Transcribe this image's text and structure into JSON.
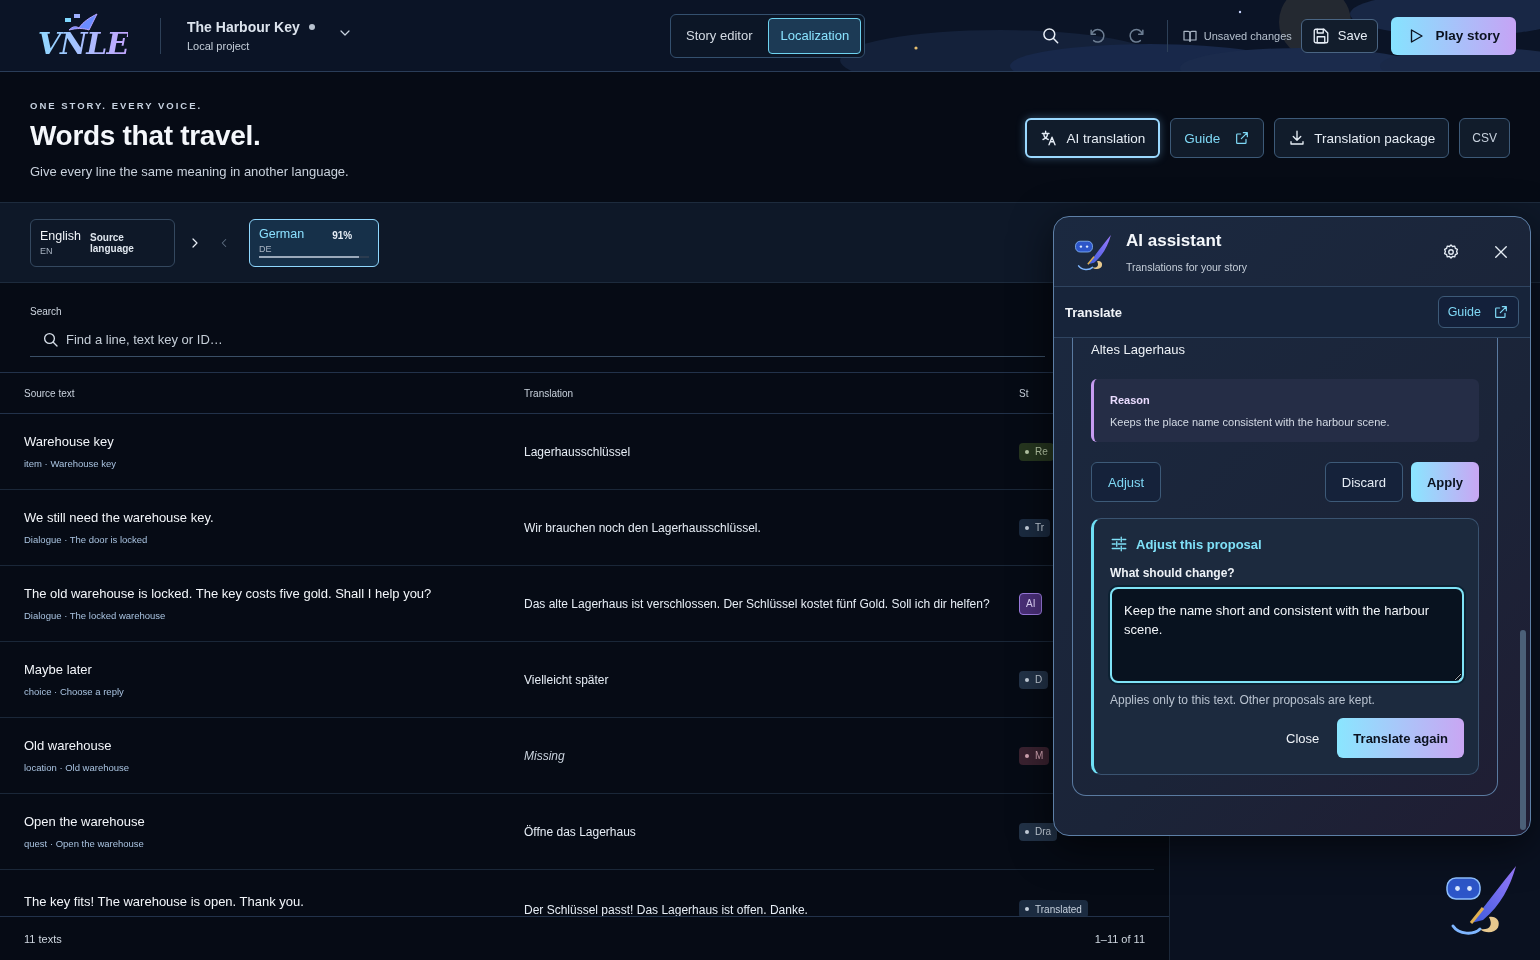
{
  "header": {
    "logo": "VNLE",
    "project": {
      "title": "The Harbour Key",
      "subtitle": "Local project"
    },
    "modes": [
      {
        "label": "Story editor",
        "selected": false
      },
      {
        "label": "Localization",
        "selected": true
      }
    ],
    "status": "Unsaved changes",
    "save": "Save",
    "play": "Play story"
  },
  "hero": {
    "eyebrow": "ONE STORY. EVERY VOICE.",
    "title": "Words that travel.",
    "subtitle": "Give every line the same meaning in another language.",
    "actions": [
      {
        "label": "AI translation",
        "kind": "ai"
      },
      {
        "label": "Guide",
        "kind": "link"
      },
      {
        "label": "Translation package",
        "kind": "download"
      },
      {
        "label": "CSV",
        "kind": "plain"
      }
    ]
  },
  "languages": {
    "source": {
      "name": "English",
      "code": "EN",
      "role": "Source language"
    },
    "targets": [
      {
        "name": "German",
        "code": "DE",
        "percent": "91%",
        "level": 0.91,
        "selected": true
      }
    ]
  },
  "search": {
    "label": "Search",
    "placeholder": "Find a line, text key or ID…"
  },
  "table": {
    "columns": [
      "Source text",
      "Translation",
      "St"
    ],
    "rows": [
      {
        "source": "Warehouse key",
        "meta": "item · Warehouse key",
        "translation": "Lagerhausschlüssel",
        "missing": false,
        "status": {
          "kind": "reviewed",
          "label": "Re"
        }
      },
      {
        "source": "We still need the warehouse key.",
        "meta": "Dialogue · The door is locked",
        "translation": "Wir brauchen noch den Lagerhausschlüssel.",
        "missing": false,
        "status": {
          "kind": "translated",
          "label": "Tr"
        }
      },
      {
        "source": "The old warehouse is locked. The key costs five gold. Shall I help you?",
        "meta": "Dialogue · The locked warehouse",
        "translation": "Das alte Lagerhaus ist verschlossen. Der Schlüssel kostet fünf Gold. Soll ich dir helfen?",
        "missing": false,
        "status": {
          "kind": "ai",
          "label": "AI"
        }
      },
      {
        "source": "Maybe later",
        "meta": "choice · Choose a reply",
        "translation": "Vielleicht später",
        "missing": false,
        "status": {
          "kind": "draft",
          "label": "D"
        }
      },
      {
        "source": "Old warehouse",
        "meta": "location · Old warehouse",
        "translation": "Missing",
        "missing": true,
        "status": {
          "kind": "missing",
          "label": "M"
        }
      },
      {
        "source": "Open the warehouse",
        "meta": "quest · Open the warehouse",
        "translation": "Öffne das Lagerhaus",
        "missing": false,
        "status": {
          "kind": "draft",
          "label": "Dra"
        }
      },
      {
        "source": "The key fits! The warehouse is open. Thank you.",
        "translation": "Der Schlüssel passt! Das Lagerhaus ist offen. Danke.",
        "missing": false,
        "status": {
          "kind": "translated",
          "label": "Translated"
        }
      }
    ],
    "count": "11 texts",
    "range": "1–11 of 11"
  },
  "assistant": {
    "title": "AI assistant",
    "subtitle": "Translations for your story",
    "section": "Translate",
    "guide": "Guide",
    "proposal": "Altes Lagerhaus",
    "reason_label": "Reason",
    "reason": "Keeps the place name consistent with the harbour scene.",
    "actions": [
      {
        "label": "Adjust",
        "kind": "secondary"
      },
      {
        "label": "Discard",
        "kind": "plain"
      },
      {
        "label": "Apply",
        "kind": "primary"
      }
    ],
    "adjust": {
      "title": "Adjust this proposal",
      "question": "What should change?",
      "value": "Keep the name short and consistent with the harbour scene.",
      "hint": "Applies only to this text. Other proposals are kept.",
      "actions": [
        {
          "label": "Close",
          "kind": "ghost"
        },
        {
          "label": "Translate again",
          "kind": "primary"
        }
      ]
    }
  }
}
